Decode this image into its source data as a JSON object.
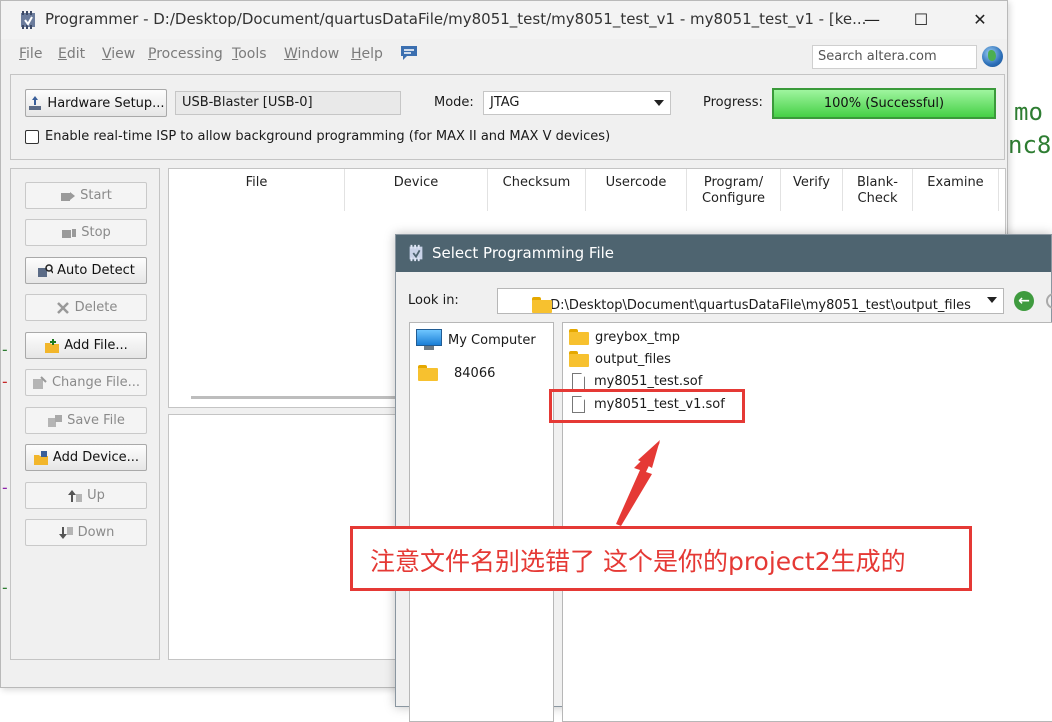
{
  "background": {
    "code_line_1": "mo",
    "code_line_2": "nc8"
  },
  "programmer": {
    "title": "Programmer - D:/Desktop/Document/quartusDataFile/my8051_test/my8051_test_v1 - my8051_test_v1 - [ke...",
    "controls": {
      "minimize": "—",
      "maximize": "☐",
      "close": "✕"
    },
    "menu": [
      "File",
      "Edit",
      "View",
      "Processing",
      "Tools",
      "Window",
      "Help"
    ],
    "search_placeholder": "Search altera.com",
    "hardware_setup_label": "Hardware Setup...",
    "hardware_value": "USB-Blaster [USB-0]",
    "mode_label": "Mode:",
    "mode_value": "JTAG",
    "progress_label": "Progress:",
    "progress_text": "100% (Successful)",
    "progress_value": 100,
    "isp_checkbox_label": "Enable real-time ISP to allow background programming (for MAX II and MAX V devices)",
    "side_buttons": {
      "start": "Start",
      "stop": "Stop",
      "auto_detect": "Auto Detect",
      "delete": "Delete",
      "add_file": "Add File...",
      "change_file": "Change File...",
      "save_file": "Save File",
      "add_device": "Add Device...",
      "up": "Up",
      "down": "Down"
    },
    "table_headers": {
      "file": "File",
      "device": "Device",
      "checksum": "Checksum",
      "usercode": "Usercode",
      "program_configure": "Program/ Configure",
      "verify": "Verify",
      "blank_check": "Blank- Check",
      "examine": "Examine"
    }
  },
  "dialog": {
    "title": "Select Programming File",
    "look_in_label": "Look in:",
    "look_in_path": "D:\\Desktop\\Document\\quartusDataFile\\my8051_test\\output_files",
    "places": {
      "my_computer": "My Computer",
      "folder_84066": "84066"
    },
    "files": {
      "greybox": "greybox_tmp",
      "output_files": "output_files",
      "sof1": "my8051_test.sof",
      "sof2": "my8051_test_v1.sof"
    }
  },
  "annotation": {
    "note": "注意文件名别选错了 这个是你的project2生成的"
  },
  "colors": {
    "accent_red": "#e53935",
    "progress_green": "#46d046",
    "dialog_title": "#4e6470"
  }
}
